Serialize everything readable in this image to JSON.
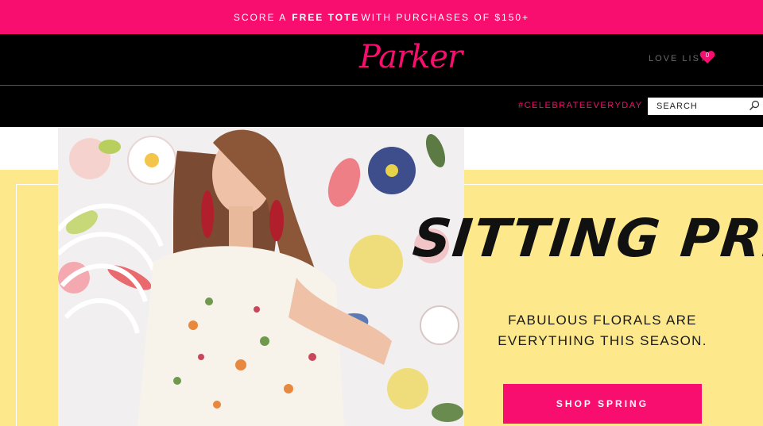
{
  "promo": {
    "prefix": "SCORE A",
    "highlight": "FREE TOTE",
    "suffix": "WITH PURCHASES OF $150+"
  },
  "header": {
    "logo_text": "Parker",
    "love_list_label": "LOVE LIST",
    "love_list_count": "0"
  },
  "nav": {
    "hashtag": "#CELEBRATEEVERYDAY",
    "search_placeholder": "SEARCH"
  },
  "hero": {
    "headline": "Sitting Pretty",
    "subhead_line1": "FABULOUS FLORALS ARE",
    "subhead_line2": "EVERYTHING THIS SEASON.",
    "cta_label": "SHOP SPRING"
  },
  "colors": {
    "brand_pink": "#f70e6e",
    "header_black": "#000000",
    "hero_yellow": "#fde98b"
  },
  "icons": {
    "love_list": "heart-icon",
    "search": "search-icon"
  }
}
